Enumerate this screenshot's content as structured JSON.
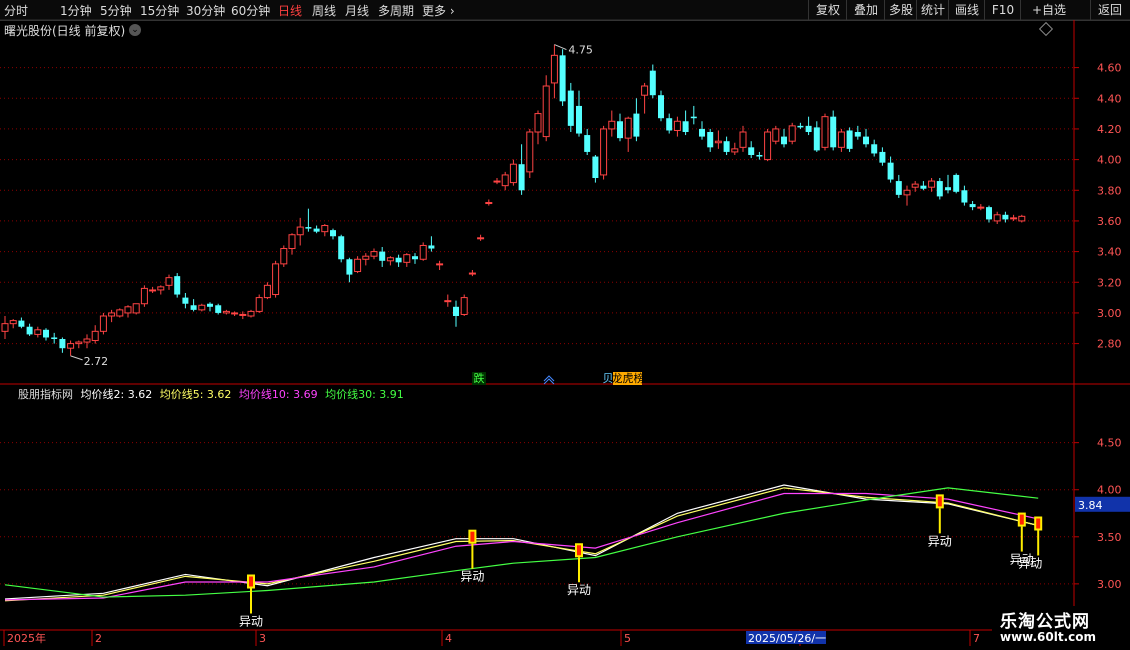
{
  "toolbar": {
    "periods": [
      "分时",
      "1分钟",
      "5分钟",
      "15分钟",
      "30分钟",
      "60分钟",
      "日线",
      "周线",
      "月线",
      "多周期",
      "更多"
    ],
    "active_period": "日线",
    "right_buttons": [
      "复权",
      "叠加",
      "多股",
      "统计",
      "画线",
      "F10",
      "+自选",
      "返回"
    ],
    "more_arrow": "›"
  },
  "stock": {
    "title": "曙光股份(日线 前复权)",
    "chevron": "⌄"
  },
  "indicator": {
    "name": "股朋指标网",
    "legend": [
      {
        "label": "均价线2: 3.62",
        "color": "#ffffff"
      },
      {
        "label": "均价线5: 3.62",
        "color": "#ffff66"
      },
      {
        "label": "均价线10: 3.69",
        "color": "#ff44ff"
      },
      {
        "label": "均价线30: 3.91",
        "color": "#44ff44"
      }
    ],
    "current_value_badge": "3.84",
    "signal_label": "异动"
  },
  "markers": {
    "die": "跌",
    "longhu": "龙虎榜",
    "bei": "贝"
  },
  "x_axis": {
    "labels": [
      "2025年",
      "2",
      "3",
      "4",
      "5",
      "6",
      "7"
    ],
    "cursor_date": "2025/05/26/一"
  },
  "watermark": {
    "line1": "乐淘公式网",
    "line2": "www.60lt.com"
  },
  "colors": {
    "up": "#ff4444",
    "down": "#54ffff",
    "grid": "#8b0000",
    "axis": "#c00000",
    "price_label": "#ff5555"
  },
  "chart_data": [
    {
      "type": "candlestick",
      "y_ticks": [
        2.8,
        3.0,
        3.2,
        3.4,
        3.6,
        3.8,
        4.0,
        4.2,
        4.4,
        4.6
      ],
      "ylim": [
        2.68,
        4.78
      ],
      "annotations": [
        {
          "label": "4.75",
          "value": 4.75,
          "type": "high"
        },
        {
          "label": "2.72",
          "value": 2.72,
          "type": "low"
        }
      ],
      "candles": [
        [
          2.88,
          2.98,
          2.83,
          2.93
        ],
        [
          2.93,
          2.96,
          2.9,
          2.95
        ],
        [
          2.95,
          2.97,
          2.9,
          2.91
        ],
        [
          2.91,
          2.93,
          2.85,
          2.86
        ],
        [
          2.86,
          2.91,
          2.84,
          2.89
        ],
        [
          2.89,
          2.9,
          2.82,
          2.84
        ],
        [
          2.84,
          2.87,
          2.8,
          2.83
        ],
        [
          2.83,
          2.84,
          2.74,
          2.77
        ],
        [
          2.77,
          2.82,
          2.72,
          2.8
        ],
        [
          2.8,
          2.82,
          2.77,
          2.81
        ],
        [
          2.81,
          2.86,
          2.77,
          2.83
        ],
        [
          2.82,
          2.92,
          2.8,
          2.88
        ],
        [
          2.88,
          3.0,
          2.86,
          2.98
        ],
        [
          2.98,
          3.02,
          2.94,
          3.0
        ],
        [
          2.98,
          3.03,
          2.97,
          3.02
        ],
        [
          3.0,
          3.05,
          2.97,
          3.04
        ],
        [
          3.0,
          3.06,
          2.99,
          3.06
        ],
        [
          3.06,
          3.18,
          3.04,
          3.16
        ],
        [
          3.15,
          3.17,
          3.13,
          3.15
        ],
        [
          3.15,
          3.18,
          3.12,
          3.17
        ],
        [
          3.18,
          3.25,
          3.15,
          3.23
        ],
        [
          3.24,
          3.26,
          3.1,
          3.12
        ],
        [
          3.1,
          3.13,
          3.03,
          3.06
        ],
        [
          3.05,
          3.09,
          3.01,
          3.02
        ],
        [
          3.02,
          3.06,
          3.01,
          3.05
        ],
        [
          3.06,
          3.07,
          3.01,
          3.04
        ],
        [
          3.05,
          3.06,
          2.99,
          3.0
        ],
        [
          3.0,
          3.02,
          2.99,
          3.01
        ],
        [
          3.0,
          3.01,
          2.98,
          3.0
        ],
        [
          2.99,
          3.01,
          2.96,
          2.99
        ],
        [
          2.98,
          3.02,
          2.97,
          3.01
        ],
        [
          3.01,
          3.12,
          3.0,
          3.1
        ],
        [
          3.1,
          3.2,
          3.09,
          3.18
        ],
        [
          3.12,
          3.34,
          3.1,
          3.32
        ],
        [
          3.32,
          3.44,
          3.3,
          3.42
        ],
        [
          3.42,
          3.52,
          3.38,
          3.51
        ],
        [
          3.51,
          3.62,
          3.44,
          3.56
        ],
        [
          3.56,
          3.68,
          3.53,
          3.55
        ],
        [
          3.55,
          3.57,
          3.52,
          3.53
        ],
        [
          3.53,
          3.58,
          3.5,
          3.57
        ],
        [
          3.54,
          3.55,
          3.48,
          3.5
        ],
        [
          3.5,
          3.51,
          3.33,
          3.35
        ],
        [
          3.35,
          3.36,
          3.2,
          3.25
        ],
        [
          3.27,
          3.37,
          3.26,
          3.35
        ],
        [
          3.35,
          3.39,
          3.31,
          3.37
        ],
        [
          3.37,
          3.42,
          3.35,
          3.4
        ],
        [
          3.4,
          3.43,
          3.3,
          3.34
        ],
        [
          3.34,
          3.37,
          3.31,
          3.36
        ],
        [
          3.36,
          3.38,
          3.3,
          3.33
        ],
        [
          3.33,
          3.39,
          3.3,
          3.38
        ],
        [
          3.37,
          3.39,
          3.32,
          3.35
        ],
        [
          3.35,
          3.46,
          3.34,
          3.44
        ],
        [
          3.44,
          3.5,
          3.4,
          3.42
        ],
        [
          3.32,
          3.34,
          3.28,
          3.32
        ],
        [
          3.08,
          3.12,
          3.04,
          3.08
        ],
        [
          3.04,
          3.08,
          2.91,
          2.98
        ],
        [
          2.99,
          3.12,
          2.98,
          3.1
        ],
        [
          3.26,
          3.28,
          3.24,
          3.26
        ],
        [
          3.49,
          3.51,
          3.47,
          3.49
        ],
        [
          3.72,
          3.74,
          3.7,
          3.72
        ],
        [
          3.86,
          3.88,
          3.84,
          3.86
        ],
        [
          3.83,
          3.92,
          3.8,
          3.9
        ],
        [
          3.85,
          4.0,
          3.83,
          3.97
        ],
        [
          3.97,
          4.1,
          3.77,
          3.8
        ],
        [
          3.92,
          4.2,
          3.88,
          4.18
        ],
        [
          4.18,
          4.32,
          4.1,
          4.3
        ],
        [
          4.15,
          4.55,
          4.12,
          4.48
        ],
        [
          4.5,
          4.75,
          4.4,
          4.68
        ],
        [
          4.68,
          4.72,
          4.35,
          4.38
        ],
        [
          4.45,
          4.5,
          4.18,
          4.22
        ],
        [
          4.35,
          4.45,
          4.15,
          4.17
        ],
        [
          4.16,
          4.2,
          4.03,
          4.05
        ],
        [
          4.02,
          4.03,
          3.85,
          3.88
        ],
        [
          3.9,
          4.22,
          3.87,
          4.2
        ],
        [
          4.2,
          4.32,
          4.15,
          4.25
        ],
        [
          4.25,
          4.3,
          4.12,
          4.14
        ],
        [
          4.14,
          4.28,
          4.05,
          4.27
        ],
        [
          4.3,
          4.4,
          4.12,
          4.15
        ],
        [
          4.42,
          4.5,
          4.3,
          4.48
        ],
        [
          4.58,
          4.62,
          4.4,
          4.42
        ],
        [
          4.42,
          4.45,
          4.25,
          4.27
        ],
        [
          4.27,
          4.3,
          4.17,
          4.19
        ],
        [
          4.19,
          4.28,
          4.15,
          4.25
        ],
        [
          4.25,
          4.32,
          4.16,
          4.18
        ],
        [
          4.28,
          4.35,
          4.23,
          4.27
        ],
        [
          4.2,
          4.25,
          4.13,
          4.15
        ],
        [
          4.18,
          4.2,
          4.05,
          4.08
        ],
        [
          4.11,
          4.19,
          4.07,
          4.12
        ],
        [
          4.12,
          4.15,
          4.03,
          4.05
        ],
        [
          4.05,
          4.11,
          4.03,
          4.07
        ],
        [
          4.08,
          4.22,
          4.05,
          4.18
        ],
        [
          4.08,
          4.12,
          4.01,
          4.03
        ],
        [
          4.03,
          4.05,
          4.0,
          4.02
        ],
        [
          4.0,
          4.2,
          3.99,
          4.18
        ],
        [
          4.12,
          4.22,
          4.1,
          4.2
        ],
        [
          4.15,
          4.2,
          4.08,
          4.1
        ],
        [
          4.12,
          4.24,
          4.1,
          4.22
        ],
        [
          4.22,
          4.24,
          4.2,
          4.21
        ],
        [
          4.22,
          4.28,
          4.16,
          4.18
        ],
        [
          4.21,
          4.25,
          4.05,
          4.06
        ],
        [
          4.08,
          4.3,
          4.06,
          4.28
        ],
        [
          4.28,
          4.32,
          4.06,
          4.08
        ],
        [
          4.08,
          4.2,
          4.05,
          4.18
        ],
        [
          4.19,
          4.21,
          4.05,
          4.07
        ],
        [
          4.18,
          4.22,
          4.13,
          4.15
        ],
        [
          4.15,
          4.2,
          4.08,
          4.1
        ],
        [
          4.1,
          4.13,
          4.02,
          4.04
        ],
        [
          4.05,
          4.08,
          3.96,
          3.98
        ],
        [
          3.98,
          4.02,
          3.85,
          3.87
        ],
        [
          3.86,
          3.9,
          3.75,
          3.77
        ],
        [
          3.77,
          3.83,
          3.7,
          3.8
        ],
        [
          3.82,
          3.86,
          3.79,
          3.84
        ],
        [
          3.83,
          3.86,
          3.8,
          3.81
        ],
        [
          3.82,
          3.88,
          3.79,
          3.86
        ],
        [
          3.86,
          3.88,
          3.74,
          3.76
        ],
        [
          3.82,
          3.9,
          3.78,
          3.8
        ],
        [
          3.9,
          3.91,
          3.78,
          3.79
        ],
        [
          3.8,
          3.83,
          3.7,
          3.72
        ],
        [
          3.71,
          3.73,
          3.67,
          3.69
        ],
        [
          3.69,
          3.71,
          3.67,
          3.69
        ],
        [
          3.69,
          3.7,
          3.59,
          3.61
        ],
        [
          3.6,
          3.66,
          3.58,
          3.64
        ],
        [
          3.64,
          3.66,
          3.59,
          3.61
        ],
        [
          3.62,
          3.64,
          3.6,
          3.62
        ],
        [
          3.6,
          3.64,
          3.59,
          3.63
        ]
      ]
    },
    {
      "type": "line",
      "y_ticks": [
        3.0,
        3.5,
        4.0,
        4.5
      ],
      "ylim": [
        2.85,
        4.9
      ],
      "series": [
        {
          "name": "均价线2",
          "color": "#ffffff",
          "x": [
            0,
            12,
            22,
            32,
            45,
            55,
            62,
            72,
            82,
            95,
            105,
            115,
            126
          ],
          "y": [
            2.84,
            2.9,
            3.1,
            2.98,
            3.28,
            3.48,
            3.48,
            3.3,
            3.75,
            4.05,
            3.9,
            3.85,
            3.62
          ]
        },
        {
          "name": "均价线5",
          "color": "#ffff66",
          "x": [
            0,
            12,
            22,
            32,
            45,
            55,
            62,
            72,
            82,
            95,
            105,
            115,
            126
          ],
          "y": [
            2.82,
            2.88,
            3.08,
            3.0,
            3.24,
            3.45,
            3.46,
            3.32,
            3.72,
            4.02,
            3.92,
            3.86,
            3.62
          ]
        },
        {
          "name": "均价线10",
          "color": "#ff44ff",
          "x": [
            0,
            12,
            22,
            32,
            45,
            55,
            62,
            72,
            82,
            95,
            105,
            115,
            126
          ],
          "y": [
            2.83,
            2.85,
            3.02,
            3.02,
            3.18,
            3.4,
            3.45,
            3.38,
            3.65,
            3.96,
            3.96,
            3.9,
            3.69
          ]
        },
        {
          "name": "均价线30",
          "color": "#44ff44",
          "x": [
            0,
            12,
            22,
            32,
            45,
            55,
            62,
            72,
            82,
            95,
            105,
            115,
            126
          ],
          "y": [
            2.99,
            2.86,
            2.88,
            2.93,
            3.02,
            3.14,
            3.22,
            3.28,
            3.5,
            3.75,
            3.89,
            4.02,
            3.91
          ]
        }
      ],
      "signals": [
        30,
        57,
        70,
        114,
        124,
        126
      ]
    }
  ]
}
